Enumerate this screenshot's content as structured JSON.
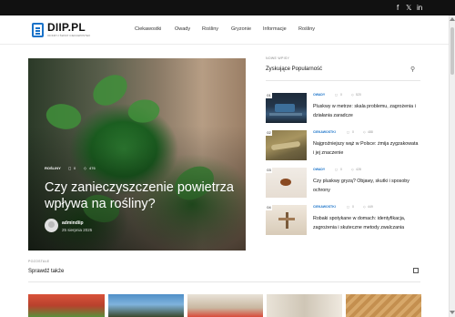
{
  "topbar": {
    "social": [
      "f",
      "𝕏",
      "in"
    ]
  },
  "logo": {
    "name": "DIIP.PL",
    "tagline": "ODKRYJ ŚWIAT CIEKAWOSTEK"
  },
  "nav": [
    "Ciekawostki",
    "Owady",
    "Rośliny",
    "Gryzonie",
    "Informacje",
    "Rośliny"
  ],
  "hero": {
    "category": "ROŚLINY",
    "views": "0",
    "likes": "476",
    "title": "Czy zanieczyszczenie powietrza wpływa na rośliny?",
    "author": "admindiip",
    "date": "25 sierpnia 2025"
  },
  "sidebar": {
    "kicker": "NOWE WPISY",
    "title": "Zyskujące Popularność",
    "posts": [
      {
        "num": "01",
        "category": "OWADY",
        "comments": "0",
        "views": "520",
        "title": "Pluskwy w metrze: skala problemu, zagrożenia i działania zaradcze",
        "category_color": "#1a73c9"
      },
      {
        "num": "02",
        "category": "CIEKAWOSTKI",
        "comments": "0",
        "views": "488",
        "title": "Najgroźniejszy wąż w Polsce: żmija zygzakowata i jej znaczenie",
        "category_color": "#1a73c9"
      },
      {
        "num": "03",
        "category": "OWADY",
        "comments": "0",
        "views": "428",
        "title": "Czy pluskwy gryzą? Objawy, skutki i sposoby ochrony",
        "category_color": "#1a73c9"
      },
      {
        "num": "04",
        "category": "CIEKAWOSTKI",
        "comments": "0",
        "views": "449",
        "title": "Robaki spotykane w domach: identyfikacja, zagrożenia i skuteczne metody zwalczania",
        "category_color": "#1a73c9"
      }
    ]
  },
  "more": {
    "kicker": "POZOSTAŁE",
    "title": "Sprawdź także"
  },
  "colors": {
    "accent": "#1a73c9",
    "topbar": "#111111"
  }
}
